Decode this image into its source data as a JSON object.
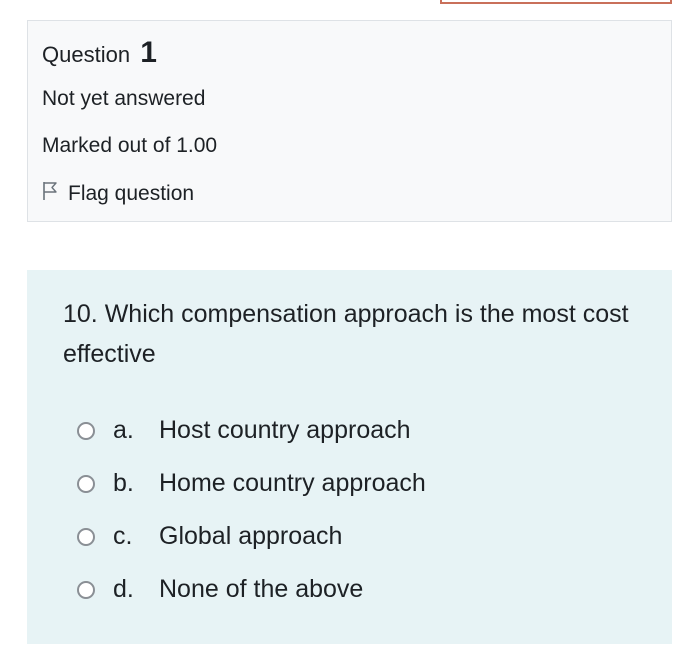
{
  "info": {
    "question_label": "Question",
    "question_number": "1",
    "state": "Not yet answered",
    "grade": "Marked out of 1.00",
    "flag_label": "Flag question"
  },
  "question": {
    "text": "10. Which compensation approach is the most cost effective",
    "answers": [
      {
        "letter": "a.",
        "label": "Host country approach"
      },
      {
        "letter": "b.",
        "label": "Home country approach"
      },
      {
        "letter": "c.",
        "label": "Global approach"
      },
      {
        "letter": "d.",
        "label": "None of the above"
      }
    ]
  },
  "colors": {
    "info_background": "#f8f9fa",
    "content_background": "#e7f3f5",
    "top_box_border": "#c9705a"
  },
  "icons": {
    "flag": "flag-outline-icon",
    "radio": "radio-unchecked-icon"
  }
}
